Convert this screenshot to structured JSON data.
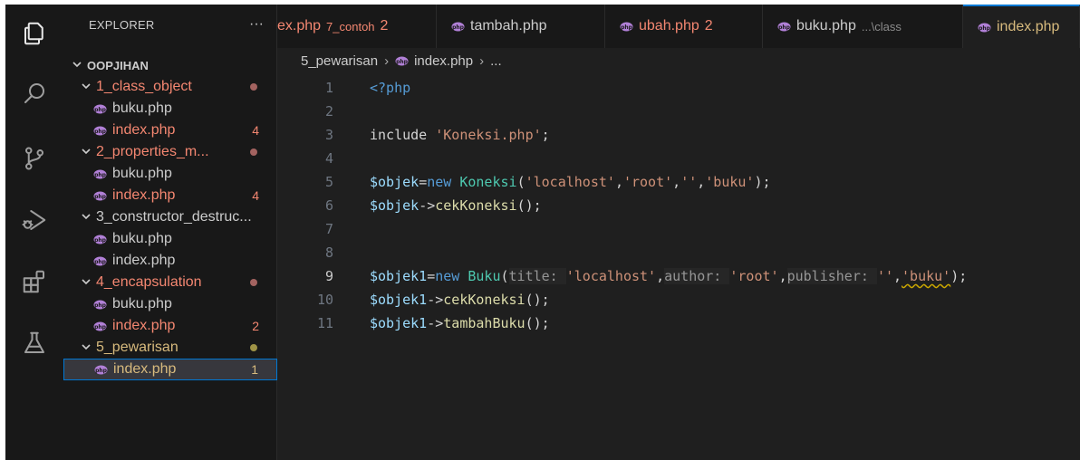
{
  "activity_bar": {
    "icons": [
      "explorer-icon",
      "search-icon",
      "source-control-icon",
      "run-debug-icon",
      "extensions-icon",
      "testing-icon"
    ]
  },
  "sidebar": {
    "title": "EXPLORER",
    "more_actions": "···",
    "root": "OOPJIHAN",
    "items": [
      {
        "type": "folder",
        "label": "1_class_object",
        "status": "dot",
        "color": "red"
      },
      {
        "type": "file",
        "label": "buku.php",
        "badge": "",
        "color": "normal"
      },
      {
        "type": "file",
        "label": "index.php",
        "badge": "4",
        "color": "red"
      },
      {
        "type": "folder",
        "label": "2_properties_m...",
        "status": "dot",
        "color": "red"
      },
      {
        "type": "file",
        "label": "buku.php",
        "badge": "",
        "color": "normal"
      },
      {
        "type": "file",
        "label": "index.php",
        "badge": "4",
        "color": "red"
      },
      {
        "type": "folder",
        "label": "3_constructor_destruc...",
        "status": "",
        "color": "normal"
      },
      {
        "type": "file",
        "label": "buku.php",
        "badge": "",
        "color": "normal"
      },
      {
        "type": "file",
        "label": "index.php",
        "badge": "",
        "color": "normal"
      },
      {
        "type": "folder",
        "label": "4_encapsulation",
        "status": "dot",
        "color": "red"
      },
      {
        "type": "file",
        "label": "buku.php",
        "badge": "",
        "color": "normal"
      },
      {
        "type": "file",
        "label": "index.php",
        "badge": "2",
        "color": "red"
      },
      {
        "type": "folder",
        "label": "5_pewarisan",
        "status": "dot",
        "color": "yellow"
      },
      {
        "type": "file",
        "label": "index.php",
        "badge": "1",
        "color": "yellow",
        "selected": true
      }
    ]
  },
  "tabs": [
    {
      "label": "ex.php",
      "description": "7_contoh",
      "count": "2",
      "color": "red"
    },
    {
      "label": "tambah.php",
      "description": "",
      "count": "",
      "color": "normal"
    },
    {
      "label": "ubah.php",
      "description": "",
      "count": "2",
      "color": "red"
    },
    {
      "label": "buku.php",
      "description": "...\\class",
      "count": "",
      "color": "normal"
    },
    {
      "label": "index.php",
      "description": "",
      "count": "",
      "color": "yellow",
      "active": true
    }
  ],
  "breadcrumb": {
    "folder": "5_pewarisan",
    "file": "index.php",
    "symbol": "..."
  },
  "editor": {
    "current_line": 9,
    "lines": [
      {
        "n": "1",
        "tokens": [
          {
            "t": "<?php",
            "c": "kw"
          }
        ]
      },
      {
        "n": "2",
        "tokens": []
      },
      {
        "n": "3",
        "tokens": [
          {
            "t": "include ",
            "c": "plain"
          },
          {
            "t": "'Koneksi.php'",
            "c": "str"
          },
          {
            "t": ";",
            "c": "plain"
          }
        ]
      },
      {
        "n": "4",
        "tokens": []
      },
      {
        "n": "5",
        "tokens": [
          {
            "t": "$objek",
            "c": "var"
          },
          {
            "t": "=",
            "c": "plain"
          },
          {
            "t": "new ",
            "c": "kw"
          },
          {
            "t": "Koneksi",
            "c": "cls"
          },
          {
            "t": "(",
            "c": "plain"
          },
          {
            "t": "'localhost'",
            "c": "str"
          },
          {
            "t": ",",
            "c": "plain"
          },
          {
            "t": "'root'",
            "c": "str"
          },
          {
            "t": ",",
            "c": "plain"
          },
          {
            "t": "''",
            "c": "str"
          },
          {
            "t": ",",
            "c": "plain"
          },
          {
            "t": "'buku'",
            "c": "str"
          },
          {
            "t": ");",
            "c": "plain"
          }
        ]
      },
      {
        "n": "6",
        "tokens": [
          {
            "t": "$objek",
            "c": "var"
          },
          {
            "t": "->",
            "c": "plain"
          },
          {
            "t": "cekKoneksi",
            "c": "fn"
          },
          {
            "t": "();",
            "c": "plain"
          }
        ]
      },
      {
        "n": "7",
        "tokens": []
      },
      {
        "n": "8",
        "tokens": []
      },
      {
        "n": "9",
        "tokens": [
          {
            "t": "$objek1",
            "c": "var"
          },
          {
            "t": "=",
            "c": "plain"
          },
          {
            "t": "new ",
            "c": "kw"
          },
          {
            "t": "Buku",
            "c": "cls"
          },
          {
            "t": "(",
            "c": "plain"
          },
          {
            "t": "title: ",
            "c": "hint"
          },
          {
            "t": "'localhost'",
            "c": "str"
          },
          {
            "t": ",",
            "c": "plain"
          },
          {
            "t": "author: ",
            "c": "hint"
          },
          {
            "t": "'root'",
            "c": "str"
          },
          {
            "t": ",",
            "c": "plain"
          },
          {
            "t": "publisher: ",
            "c": "hint"
          },
          {
            "t": "''",
            "c": "str"
          },
          {
            "t": ",",
            "c": "plain"
          },
          {
            "t": "'buku'",
            "c": "str squig"
          },
          {
            "t": ");",
            "c": "plain"
          }
        ]
      },
      {
        "n": "10",
        "tokens": [
          {
            "t": "$objek1",
            "c": "var"
          },
          {
            "t": "->",
            "c": "plain"
          },
          {
            "t": "cekKoneksi",
            "c": "fn"
          },
          {
            "t": "();",
            "c": "plain"
          }
        ]
      },
      {
        "n": "11",
        "tokens": [
          {
            "t": "$objek1",
            "c": "var"
          },
          {
            "t": "->",
            "c": "plain"
          },
          {
            "t": "tambahBuku",
            "c": "fn"
          },
          {
            "t": "();",
            "c": "plain"
          }
        ]
      }
    ]
  },
  "colors": {
    "accent": "#0078d4",
    "error_red": "#f48771",
    "warning_yellow": "#d7ba7d",
    "php_icon": "#b180d7"
  }
}
